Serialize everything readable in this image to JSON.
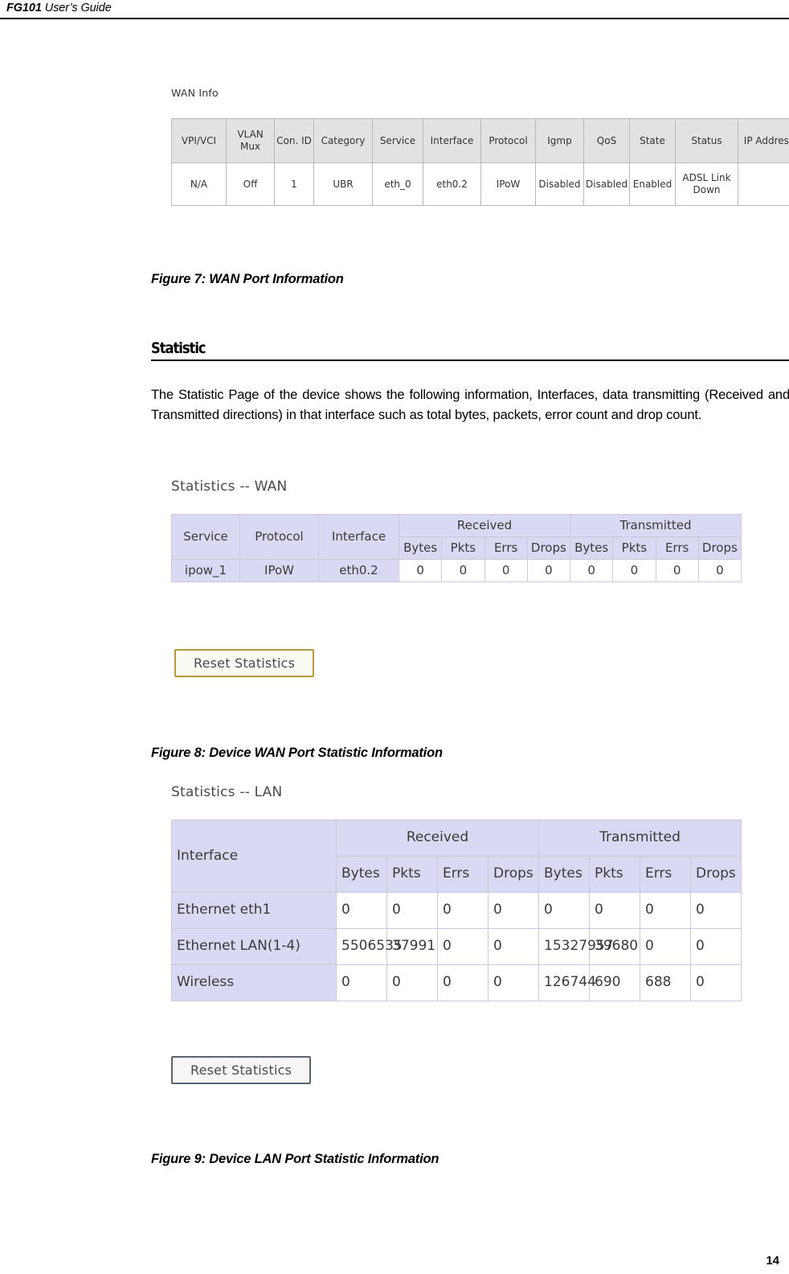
{
  "header": {
    "product": "FG101",
    "title": " User’s Guide"
  },
  "page_number": "14",
  "figure7": {
    "panel_title": "WAN Info",
    "caption": "Figure 7: WAN Port Information",
    "columns": [
      "VPI/VCI",
      "VLAN Mux",
      "Con. ID",
      "Category",
      "Service",
      "Interface",
      "Protocol",
      "Igmp",
      "QoS",
      "State",
      "Status",
      "IP Address"
    ],
    "rows": [
      [
        "N/A",
        "Off",
        "1",
        "UBR",
        "eth_0",
        "eth0.2",
        "IPoW",
        "Disabled",
        "Disabled",
        "Enabled",
        "ADSL Link Down",
        ""
      ]
    ]
  },
  "section": {
    "heading": "Statistic",
    "paragraph": "The Statistic Page of the device shows the following information, Interfaces, data transmitting (Received and Transmitted directions) in that interface such as total bytes, packets, error count and drop count."
  },
  "figure8": {
    "panel_title": "Statistics -- WAN",
    "caption": "Figure 8: Device WAN Port Statistic Information",
    "header_row1": [
      "Service",
      "Protocol",
      "Interface",
      "Received",
      "Transmitted",
      ""
    ],
    "header_row2": [
      "Bytes",
      "Pkts",
      "Errs",
      "Drops",
      "Bytes",
      "Pkts",
      "Errs",
      "Drops"
    ],
    "rows": [
      {
        "service": "ipow_1",
        "protocol": "IPoW",
        "interface": "eth0.2",
        "received": [
          "0",
          "0",
          "0",
          "0"
        ],
        "transmitted": [
          "0",
          "0",
          "0",
          "0"
        ]
      }
    ],
    "reset_button": "Reset Statistics"
  },
  "figure9": {
    "panel_title": "Statistics -- LAN",
    "caption": "Figure 9: Device LAN Port Statistic Information",
    "header_row1": [
      "Interface",
      "Received",
      "Transmitted"
    ],
    "header_row2": [
      "Bytes",
      "Pkts",
      "Errs",
      "Drops",
      "Bytes",
      "Pkts",
      "Errs",
      "Drops"
    ],
    "rows": [
      {
        "interface": "Ethernet eth1",
        "received": [
          "0",
          "0",
          "0",
          "0"
        ],
        "transmitted": [
          "0",
          "0",
          "0",
          "0"
        ]
      },
      {
        "interface": "Ethernet LAN(1-4)",
        "received": [
          "5506535",
          "37991",
          "0",
          "0"
        ],
        "transmitted": [
          "15327957",
          "39680",
          "0",
          "0"
        ]
      },
      {
        "interface": "Wireless",
        "received": [
          "0",
          "0",
          "0",
          "0"
        ],
        "transmitted": [
          "126744",
          "690",
          "688",
          "0"
        ]
      }
    ],
    "reset_button": "Reset Statistics"
  },
  "colors": {
    "table_header_gray": "#e2e2e2",
    "table_header_lavender": "#d9d9f3",
    "button_gold_border": "#b49a3c",
    "button_gray_border": "#5a6472"
  }
}
